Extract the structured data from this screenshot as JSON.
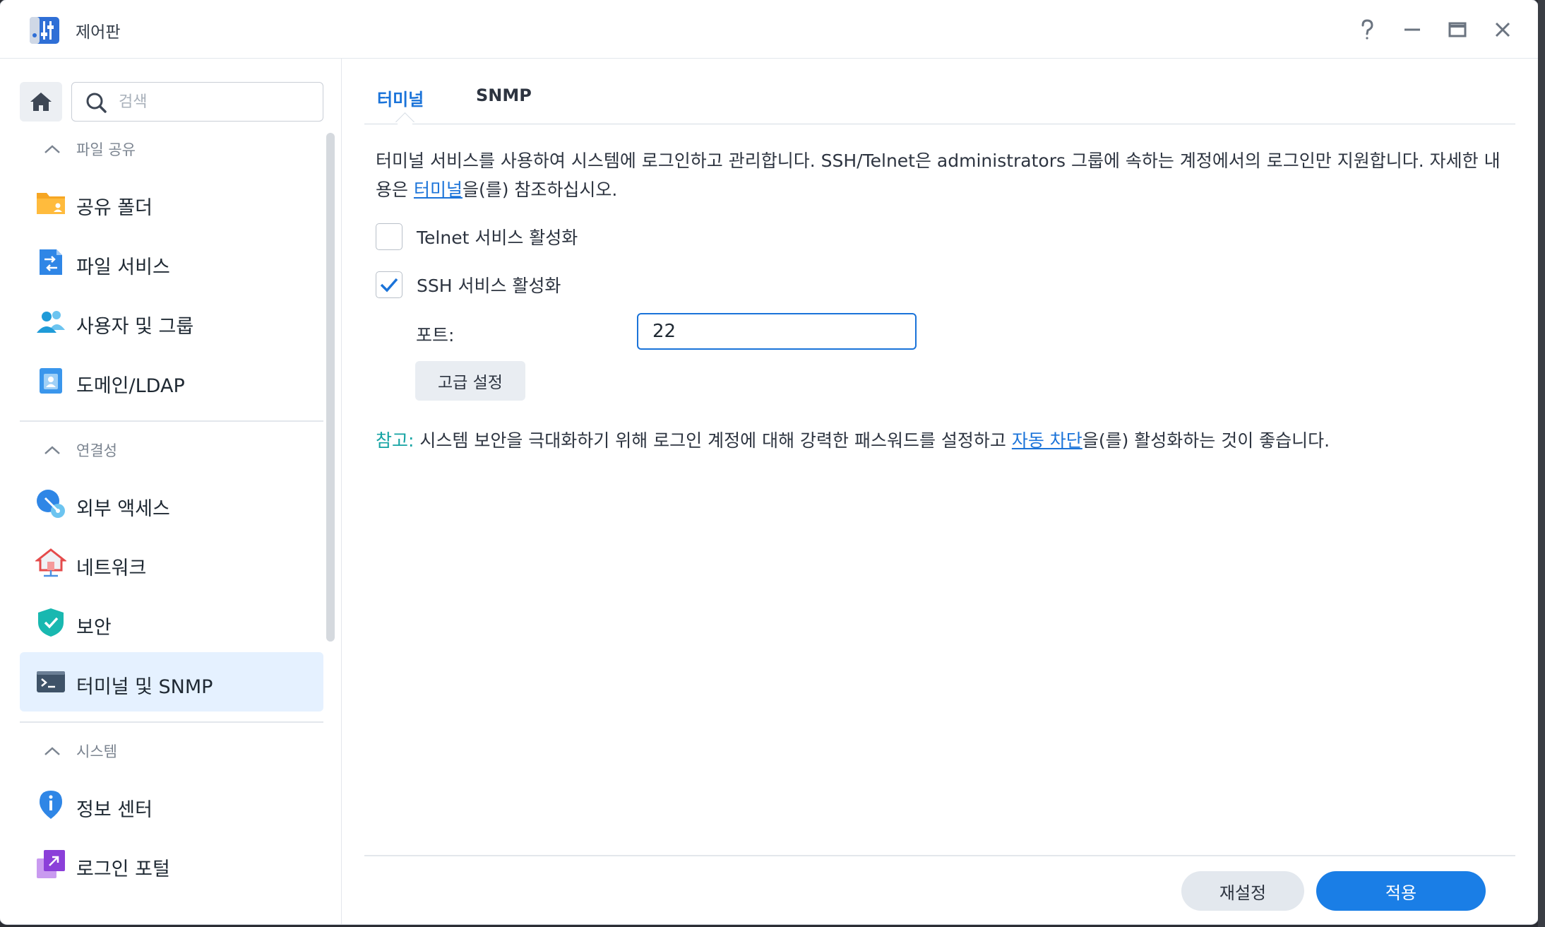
{
  "window": {
    "title": "제어판"
  },
  "sidebar": {
    "search_placeholder": "검색",
    "sections": [
      {
        "label": "파일 공유",
        "items": [
          "공유 폴더",
          "파일 서비스",
          "사용자 및 그룹",
          "도메인/LDAP"
        ]
      },
      {
        "label": "연결성",
        "items": [
          "외부 액세스",
          "네트워크",
          "보안",
          "터미널 및 SNMP"
        ]
      },
      {
        "label": "시스템",
        "items": [
          "정보 센터",
          "로그인 포털"
        ]
      }
    ],
    "active_item": "터미널 및 SNMP"
  },
  "tabs": [
    {
      "label": "터미널",
      "active": true
    },
    {
      "label": "SNMP",
      "active": false
    }
  ],
  "content": {
    "desc_part1": "터미널 서비스를 사용하여 시스템에 로그인하고 관리합니다. SSH/Telnet은 administrators 그룹에 속하는 계정에서의 로그인만 지원합니다. 자세한 내용은 ",
    "desc_link": "터미널",
    "desc_part2": "을(를) 참조하십시오.",
    "telnet_label": "Telnet 서비스 활성화",
    "telnet_checked": false,
    "ssh_label": "SSH 서비스 활성화",
    "ssh_checked": true,
    "port_label": "포트:",
    "port_value": "22",
    "advanced_button": "고급 설정",
    "note_label": "참고:",
    "note_part1": " 시스템 보안을 극대화하기 위해 로그인 계정에 대해 강력한 패스워드를 설정하고 ",
    "note_link": "자동 차단",
    "note_part2": "을(를) 활성화하는 것이 좋습니다."
  },
  "footer": {
    "reset_label": "재설정",
    "apply_label": "적용"
  },
  "colors": {
    "accent": "#1a73d9",
    "note": "#14a3a3",
    "active_bg": "#e5f1ff"
  }
}
